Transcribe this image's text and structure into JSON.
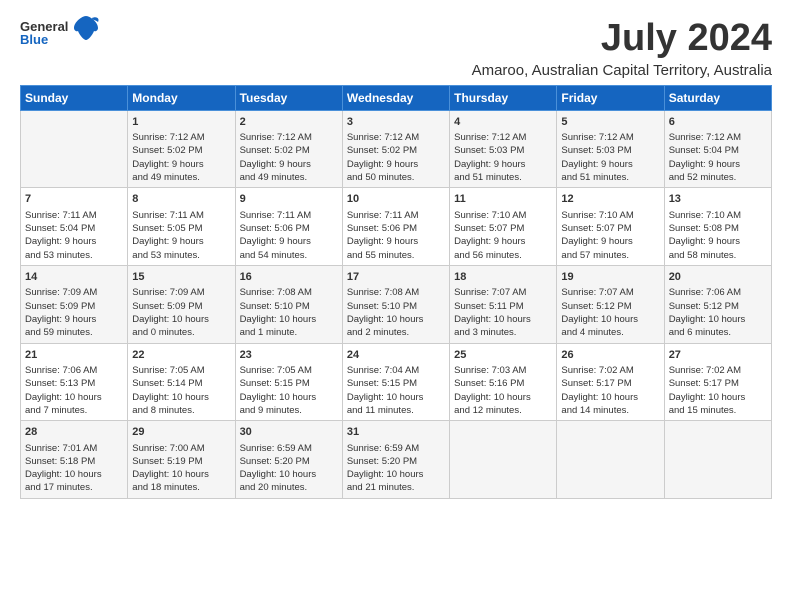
{
  "header": {
    "logo_general": "General",
    "logo_blue": "Blue",
    "main_title": "July 2024",
    "sub_title": "Amaroo, Australian Capital Territory, Australia"
  },
  "calendar": {
    "days_of_week": [
      "Sunday",
      "Monday",
      "Tuesday",
      "Wednesday",
      "Thursday",
      "Friday",
      "Saturday"
    ],
    "weeks": [
      [
        {
          "day": "",
          "lines": []
        },
        {
          "day": "1",
          "lines": [
            "Sunrise: 7:12 AM",
            "Sunset: 5:02 PM",
            "Daylight: 9 hours",
            "and 49 minutes."
          ]
        },
        {
          "day": "2",
          "lines": [
            "Sunrise: 7:12 AM",
            "Sunset: 5:02 PM",
            "Daylight: 9 hours",
            "and 49 minutes."
          ]
        },
        {
          "day": "3",
          "lines": [
            "Sunrise: 7:12 AM",
            "Sunset: 5:02 PM",
            "Daylight: 9 hours",
            "and 50 minutes."
          ]
        },
        {
          "day": "4",
          "lines": [
            "Sunrise: 7:12 AM",
            "Sunset: 5:03 PM",
            "Daylight: 9 hours",
            "and 51 minutes."
          ]
        },
        {
          "day": "5",
          "lines": [
            "Sunrise: 7:12 AM",
            "Sunset: 5:03 PM",
            "Daylight: 9 hours",
            "and 51 minutes."
          ]
        },
        {
          "day": "6",
          "lines": [
            "Sunrise: 7:12 AM",
            "Sunset: 5:04 PM",
            "Daylight: 9 hours",
            "and 52 minutes."
          ]
        }
      ],
      [
        {
          "day": "7",
          "lines": [
            "Sunrise: 7:11 AM",
            "Sunset: 5:04 PM",
            "Daylight: 9 hours",
            "and 53 minutes."
          ]
        },
        {
          "day": "8",
          "lines": [
            "Sunrise: 7:11 AM",
            "Sunset: 5:05 PM",
            "Daylight: 9 hours",
            "and 53 minutes."
          ]
        },
        {
          "day": "9",
          "lines": [
            "Sunrise: 7:11 AM",
            "Sunset: 5:06 PM",
            "Daylight: 9 hours",
            "and 54 minutes."
          ]
        },
        {
          "day": "10",
          "lines": [
            "Sunrise: 7:11 AM",
            "Sunset: 5:06 PM",
            "Daylight: 9 hours",
            "and 55 minutes."
          ]
        },
        {
          "day": "11",
          "lines": [
            "Sunrise: 7:10 AM",
            "Sunset: 5:07 PM",
            "Daylight: 9 hours",
            "and 56 minutes."
          ]
        },
        {
          "day": "12",
          "lines": [
            "Sunrise: 7:10 AM",
            "Sunset: 5:07 PM",
            "Daylight: 9 hours",
            "and 57 minutes."
          ]
        },
        {
          "day": "13",
          "lines": [
            "Sunrise: 7:10 AM",
            "Sunset: 5:08 PM",
            "Daylight: 9 hours",
            "and 58 minutes."
          ]
        }
      ],
      [
        {
          "day": "14",
          "lines": [
            "Sunrise: 7:09 AM",
            "Sunset: 5:09 PM",
            "Daylight: 9 hours",
            "and 59 minutes."
          ]
        },
        {
          "day": "15",
          "lines": [
            "Sunrise: 7:09 AM",
            "Sunset: 5:09 PM",
            "Daylight: 10 hours",
            "and 0 minutes."
          ]
        },
        {
          "day": "16",
          "lines": [
            "Sunrise: 7:08 AM",
            "Sunset: 5:10 PM",
            "Daylight: 10 hours",
            "and 1 minute."
          ]
        },
        {
          "day": "17",
          "lines": [
            "Sunrise: 7:08 AM",
            "Sunset: 5:10 PM",
            "Daylight: 10 hours",
            "and 2 minutes."
          ]
        },
        {
          "day": "18",
          "lines": [
            "Sunrise: 7:07 AM",
            "Sunset: 5:11 PM",
            "Daylight: 10 hours",
            "and 3 minutes."
          ]
        },
        {
          "day": "19",
          "lines": [
            "Sunrise: 7:07 AM",
            "Sunset: 5:12 PM",
            "Daylight: 10 hours",
            "and 4 minutes."
          ]
        },
        {
          "day": "20",
          "lines": [
            "Sunrise: 7:06 AM",
            "Sunset: 5:12 PM",
            "Daylight: 10 hours",
            "and 6 minutes."
          ]
        }
      ],
      [
        {
          "day": "21",
          "lines": [
            "Sunrise: 7:06 AM",
            "Sunset: 5:13 PM",
            "Daylight: 10 hours",
            "and 7 minutes."
          ]
        },
        {
          "day": "22",
          "lines": [
            "Sunrise: 7:05 AM",
            "Sunset: 5:14 PM",
            "Daylight: 10 hours",
            "and 8 minutes."
          ]
        },
        {
          "day": "23",
          "lines": [
            "Sunrise: 7:05 AM",
            "Sunset: 5:15 PM",
            "Daylight: 10 hours",
            "and 9 minutes."
          ]
        },
        {
          "day": "24",
          "lines": [
            "Sunrise: 7:04 AM",
            "Sunset: 5:15 PM",
            "Daylight: 10 hours",
            "and 11 minutes."
          ]
        },
        {
          "day": "25",
          "lines": [
            "Sunrise: 7:03 AM",
            "Sunset: 5:16 PM",
            "Daylight: 10 hours",
            "and 12 minutes."
          ]
        },
        {
          "day": "26",
          "lines": [
            "Sunrise: 7:02 AM",
            "Sunset: 5:17 PM",
            "Daylight: 10 hours",
            "and 14 minutes."
          ]
        },
        {
          "day": "27",
          "lines": [
            "Sunrise: 7:02 AM",
            "Sunset: 5:17 PM",
            "Daylight: 10 hours",
            "and 15 minutes."
          ]
        }
      ],
      [
        {
          "day": "28",
          "lines": [
            "Sunrise: 7:01 AM",
            "Sunset: 5:18 PM",
            "Daylight: 10 hours",
            "and 17 minutes."
          ]
        },
        {
          "day": "29",
          "lines": [
            "Sunrise: 7:00 AM",
            "Sunset: 5:19 PM",
            "Daylight: 10 hours",
            "and 18 minutes."
          ]
        },
        {
          "day": "30",
          "lines": [
            "Sunrise: 6:59 AM",
            "Sunset: 5:20 PM",
            "Daylight: 10 hours",
            "and 20 minutes."
          ]
        },
        {
          "day": "31",
          "lines": [
            "Sunrise: 6:59 AM",
            "Sunset: 5:20 PM",
            "Daylight: 10 hours",
            "and 21 minutes."
          ]
        },
        {
          "day": "",
          "lines": []
        },
        {
          "day": "",
          "lines": []
        },
        {
          "day": "",
          "lines": []
        }
      ]
    ]
  }
}
